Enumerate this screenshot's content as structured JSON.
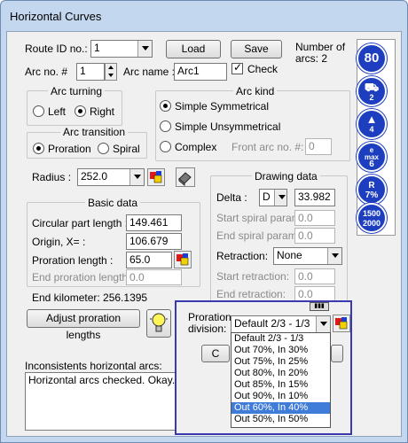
{
  "window": {
    "title": "Horizontal Curves"
  },
  "top": {
    "route_id_label": "Route ID no.:",
    "route_id_value": "1",
    "load_button": "Load",
    "save_button": "Save",
    "number_of_arcs_label": "Number of",
    "number_of_arcs_value": "arcs: 2",
    "arc_no_label": "Arc no. #",
    "arc_no_value": "1",
    "arc_name_label": "Arc name :",
    "arc_name_value": "Arc1",
    "check_label": "Check",
    "check_checked": true
  },
  "arc_turning": {
    "title": "Arc turning",
    "left": "Left",
    "right": "Right",
    "selected": "Right"
  },
  "arc_kind": {
    "title": "Arc kind",
    "simple_symmetrical": "Simple Symmetrical",
    "simple_unsymmetrical": "Simple Unsymmetrical",
    "complex": "Complex",
    "front_arc_label": "Front arc no. #:",
    "front_arc_value": "0",
    "selected": "Simple Symmetrical"
  },
  "arc_transition": {
    "title": "Arc transition",
    "proration": "Proration",
    "spiral": "Spiral",
    "selected": "Proration"
  },
  "radius": {
    "label": "Radius :",
    "value": "252.0"
  },
  "basic_data": {
    "title": "Basic data",
    "circular_part_length_label": "Circular part length :",
    "circular_part_length_value": "149.461",
    "origin_label": "Origin, X= :",
    "origin_value": "106.679",
    "proration_length_label": "Proration length :",
    "proration_length_value": "65.0",
    "end_proration_length_label": "End proration length :",
    "end_proration_length_value": "0.0"
  },
  "end_kilometer": "End kilometer: 256.1395",
  "adjust_button": "Adjust proration lengths",
  "drawing_data": {
    "title": "Drawing data",
    "delta_label": "Delta :",
    "delta_unit": "D",
    "delta_value": "33.982",
    "start_spiral_label": "Start spiral param.:",
    "start_spiral_value": "0.0",
    "end_spiral_label": "End spiral param.:",
    "end_spiral_value": "0.0",
    "retraction_label": "Retraction:",
    "retraction_value": "None",
    "start_retraction_label": "Start retraction:",
    "start_retraction_value": "0.0",
    "end_retraction_label": "End retraction:",
    "end_retraction_value": "0.0"
  },
  "proration_division": {
    "label_line1": "Proration",
    "label_line2": "division:",
    "selected": "Default 2/3 - 1/3",
    "options": [
      "Default 2/3 - 1/3",
      "Out 70%, In 30%",
      "Out 75%, In 25%",
      "Out 80%, In 20%",
      "Out 85%, In 15%",
      "Out 90%, In 10%",
      "Out 60%, In 40%",
      "Out 50%, In 50%"
    ],
    "highlighted_index": 6,
    "partial_button_text": "C"
  },
  "inconsistents": {
    "label": "Inconsistents horizontal arcs:",
    "text": "Horizontal arcs checked. Okay."
  },
  "signs": {
    "speed": "80",
    "truck_sub": "2",
    "lane_sub": "4",
    "emax_top": "e",
    "emax_mid": "max",
    "emax_val": "6",
    "r_top": "R",
    "r_val": "7%",
    "range_top": "1500",
    "range_bot": "2000"
  },
  "colors": {
    "accent": "#1d3fbf",
    "highlight": "#3f7bd9",
    "popup_border": "#3a3ab0"
  }
}
